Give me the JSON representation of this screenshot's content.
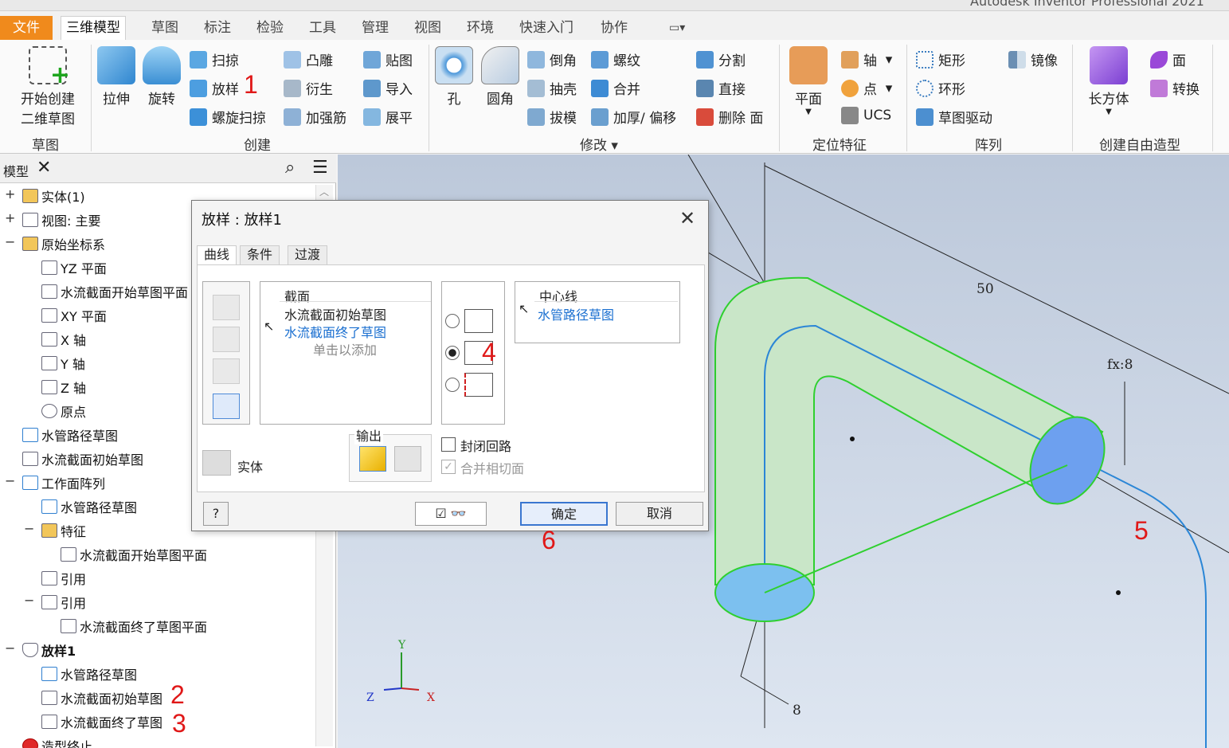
{
  "window": {
    "app_title": "Autodesk Inventor Professional 2021"
  },
  "tabs": [
    {
      "label": "文件"
    },
    {
      "label": "三维模型"
    },
    {
      "label": "草图"
    },
    {
      "label": "标注"
    },
    {
      "label": "检验"
    },
    {
      "label": "工具"
    },
    {
      "label": "管理"
    },
    {
      "label": "视图"
    },
    {
      "label": "环境"
    },
    {
      "label": "快速入门"
    },
    {
      "label": "协作"
    }
  ],
  "ribbon": {
    "sketch": {
      "start_sketch_line1": "开始创建",
      "start_sketch_line2": "二维草图",
      "group": "草图"
    },
    "create": {
      "extrude": "拉伸",
      "revolve": "旋转",
      "sweep": "扫掠",
      "loft": "放样",
      "coil": "螺旋扫掠",
      "emboss": "凸雕",
      "derive": "衍生",
      "rib": "加强筋",
      "decal": "贴图",
      "import": "导入",
      "unfold": "展平",
      "group": "创建"
    },
    "modify": {
      "hole": "孔",
      "fillet": "圆角",
      "chamfer": "倒角",
      "shell": "抽壳",
      "draft": "拔模",
      "thread": "螺纹",
      "combine": "合并",
      "thicken": "加厚/ 偏移",
      "split": "分割",
      "direct": "直接",
      "delete_face": "删除 面",
      "group": "修改"
    },
    "work": {
      "plane": "平面",
      "axis": "轴",
      "point": "点",
      "ucs": "UCS",
      "group": "定位特征"
    },
    "pattern": {
      "rect": "矩形",
      "circular": "环形",
      "sketch_driven": "草图驱动",
      "mirror": "镜像",
      "group": "阵列"
    },
    "freeform": {
      "box": "长方体",
      "face": "面",
      "convert": "转换",
      "group": "创建自由造型"
    }
  },
  "browser": {
    "title": "模型",
    "items": [
      {
        "label": "实体(1)"
      },
      {
        "label": "视图: 主要"
      },
      {
        "label": "原始坐标系"
      },
      {
        "label": "YZ 平面"
      },
      {
        "label": "水流截面开始草图平面"
      },
      {
        "label": "XY 平面"
      },
      {
        "label": "X 轴"
      },
      {
        "label": "Y 轴"
      },
      {
        "label": "Z 轴"
      },
      {
        "label": "原点"
      },
      {
        "label": "水管路径草图"
      },
      {
        "label": "水流截面初始草图"
      },
      {
        "label": "工作面阵列"
      },
      {
        "label": "水管路径草图"
      },
      {
        "label": "特征"
      },
      {
        "label": "水流截面开始草图平面"
      },
      {
        "label": "引用"
      },
      {
        "label": "引用"
      },
      {
        "label": "水流截面终了草图平面"
      },
      {
        "label": "放样1"
      },
      {
        "label": "水管路径草图"
      },
      {
        "label": "水流截面初始草图"
      },
      {
        "label": "水流截面终了草图"
      },
      {
        "label": "造型终止"
      }
    ]
  },
  "dialog": {
    "title": "放样 : 放样1",
    "tabs": [
      {
        "label": "曲线"
      },
      {
        "label": "条件"
      },
      {
        "label": "过渡"
      }
    ],
    "sections": {
      "header": "截面",
      "item1": "水流截面初始草图",
      "item2": "水流截面终了草图",
      "add_hint": "单击以添加"
    },
    "rails": {
      "header": "中心线",
      "item1": "水管路径草图"
    },
    "output_label": "输出",
    "solid_label": "实体",
    "closed_loop": "封闭回路",
    "merge_tangent": "合并相切面",
    "ok": "确定",
    "cancel": "取消"
  },
  "viewport": {
    "dim_50": "50",
    "dim_fx8": "fx:8",
    "dim_8": "8",
    "axis_x": "X",
    "axis_y": "Y",
    "axis_z": "Z"
  },
  "annotations": {
    "n1": "1",
    "n2": "2",
    "n3": "3",
    "n4": "4",
    "n5": "5",
    "n6": "6"
  }
}
